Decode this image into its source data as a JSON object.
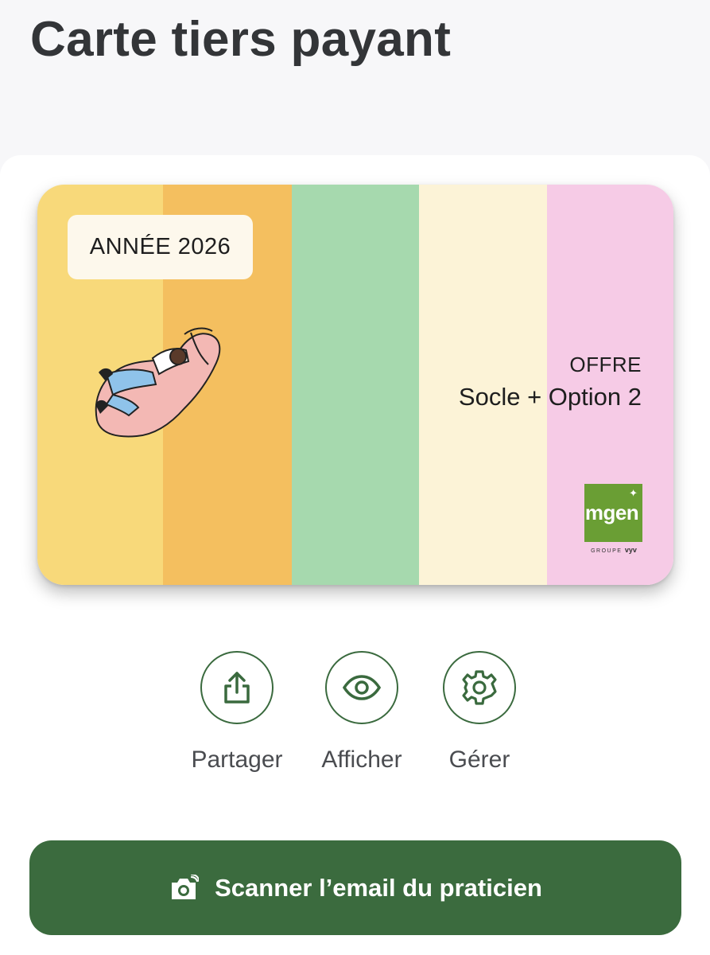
{
  "header": {
    "title": "Carte tiers payant"
  },
  "card": {
    "year_label": "ANNÉE 2026",
    "offer_label": "OFFRE",
    "offer_value": "Socle + Option 2",
    "stripe_colors": [
      "#f8d97a",
      "#f4bf5f",
      "#a6d9ae",
      "#fcf3d7",
      "#f6cbe6"
    ],
    "logo": {
      "text": "mgen",
      "subtitle_prefix": "GROUPE",
      "subtitle_brand": "vyv",
      "color": "#6a9e34"
    }
  },
  "actions": [
    {
      "label": "Partager",
      "icon": "share-icon"
    },
    {
      "label": "Afficher",
      "icon": "eye-icon"
    },
    {
      "label": "Gérer",
      "icon": "gear-icon"
    }
  ],
  "scan_button": {
    "label": "Scanner l’email du praticien",
    "icon": "camera-icon"
  },
  "colors": {
    "accent": "#3b6b3e",
    "title": "#333538"
  }
}
